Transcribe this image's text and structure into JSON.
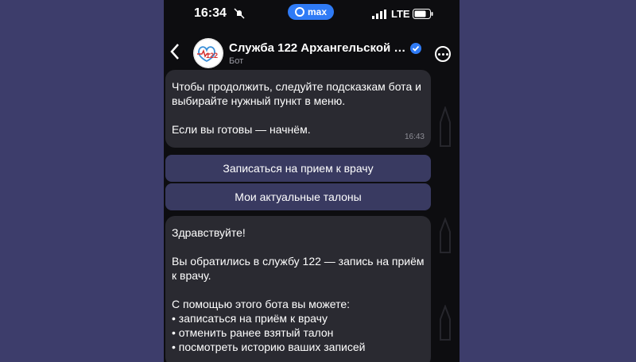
{
  "status_bar": {
    "time": "16:34",
    "app_badge": "max",
    "network": "LTE"
  },
  "header": {
    "title": "Служба 122 Архангельской о...",
    "subtitle": "Бот",
    "avatar_text": "122"
  },
  "messages": {
    "m1": {
      "p1": "Чтобы продолжить, следуйте подсказкам бота и выбирайте нужный пункт в меню.",
      "p2": "Если вы готовы — начнём.",
      "time": "16:43"
    },
    "buttons": [
      "Записаться на прием к врачу",
      "Мои актуальные талоны"
    ],
    "m2": {
      "p1": "Здравствуйте!",
      "p2": "Вы обратились в службу 122 — запись на приём к врачу.",
      "p3": "С помощью этого бота вы можете:",
      "bullets": [
        "• записаться на приём к врачу",
        "• отменить ранее взятый талон",
        "• посмотреть историю ваших записей"
      ]
    }
  },
  "colors": {
    "page_bg": "#3d3d6b",
    "phone_bg": "#0d0d10",
    "bubble": "#2a2a31",
    "button": "#393a61",
    "accent": "#2f7bf6"
  }
}
